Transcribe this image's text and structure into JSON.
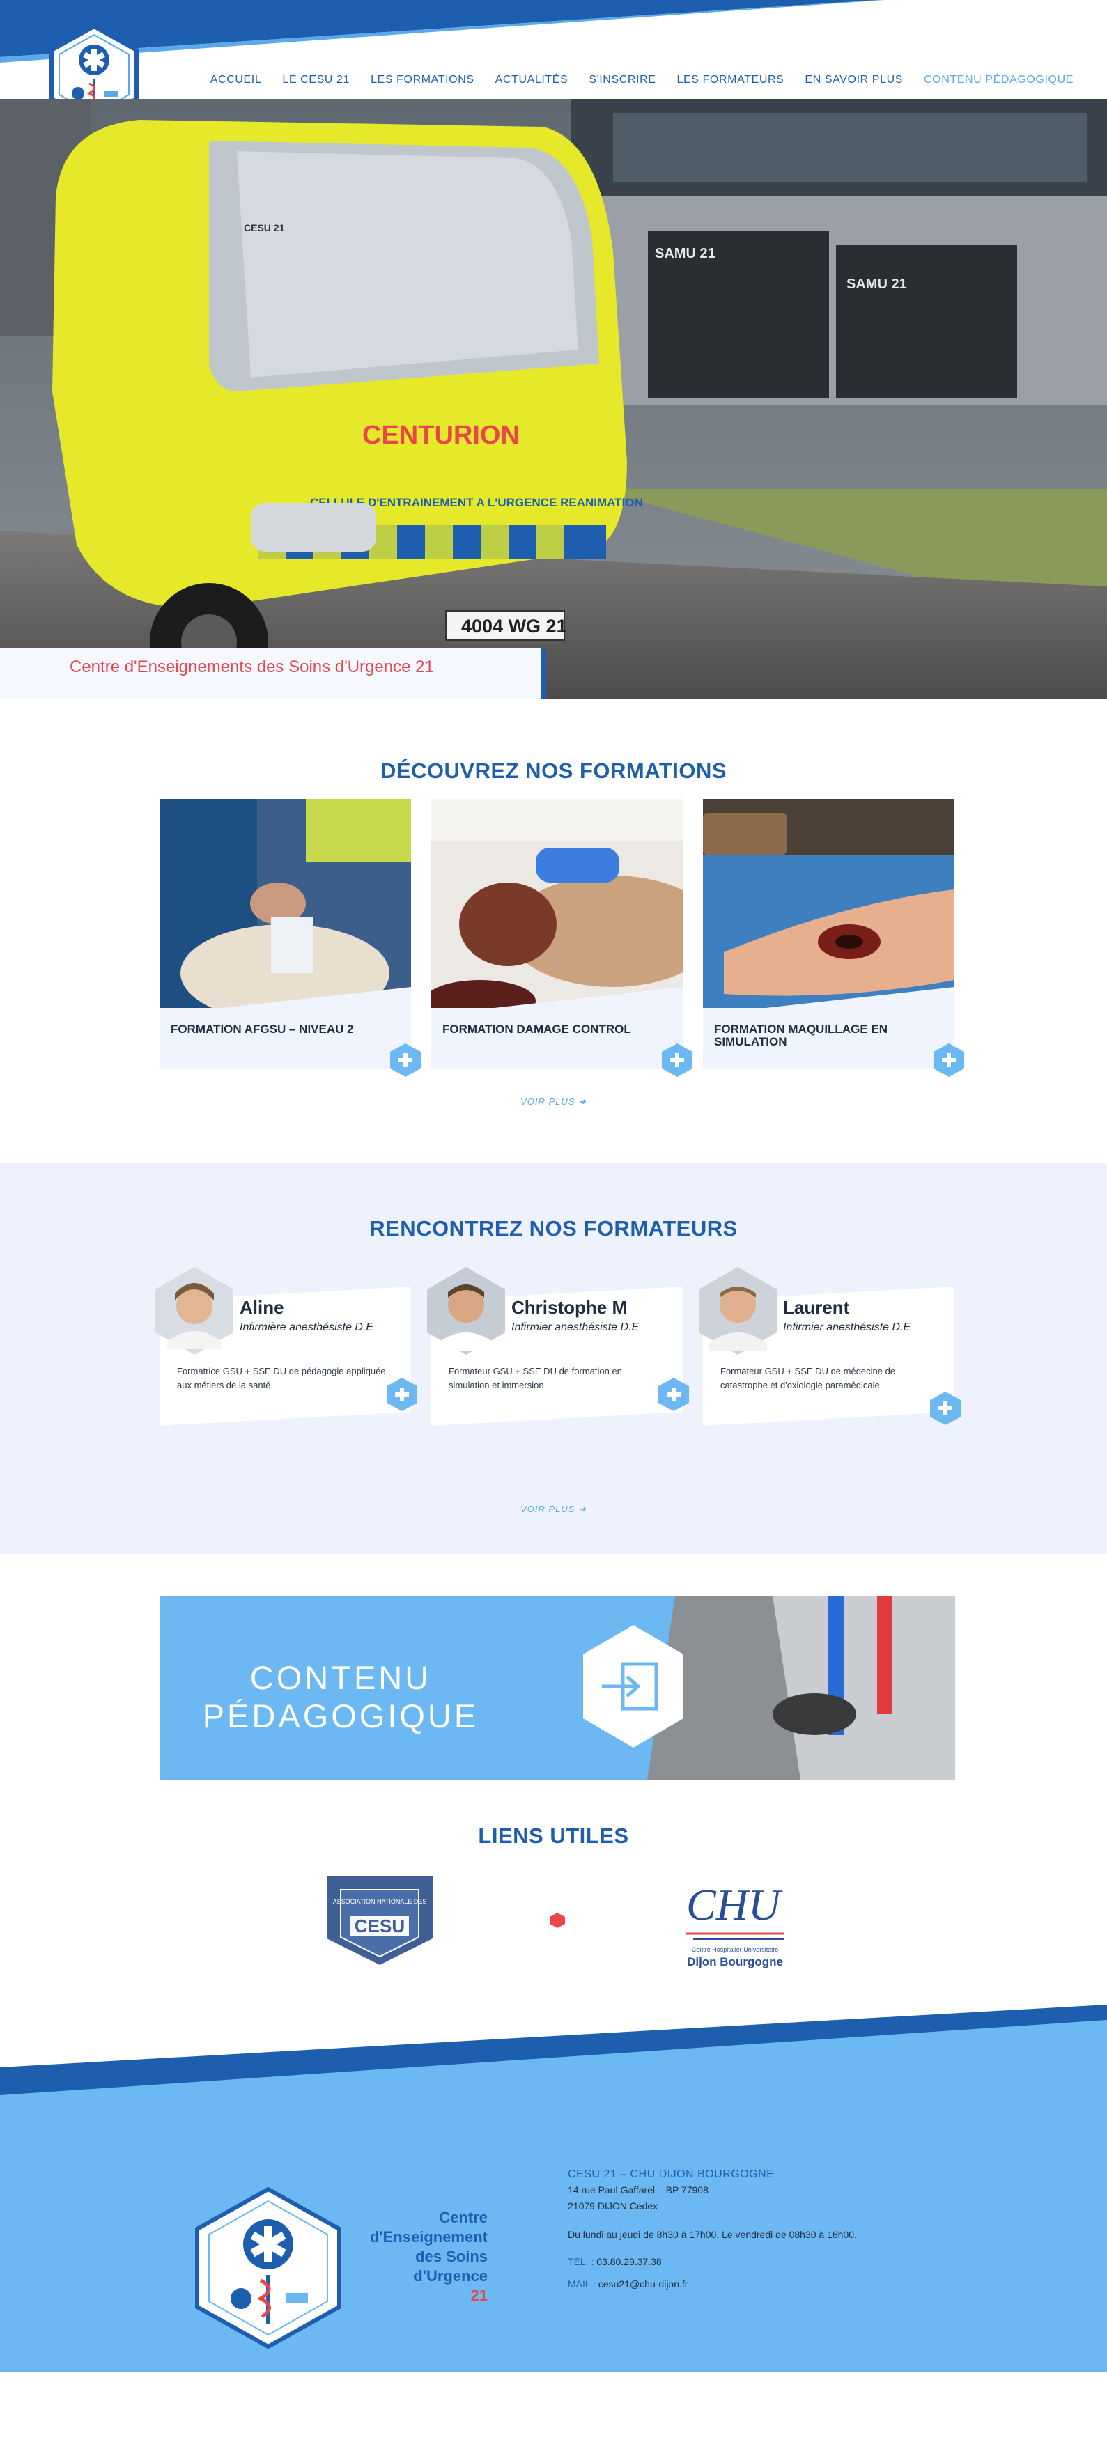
{
  "nav": {
    "items": [
      {
        "label": "ACCUEIL",
        "active": false
      },
      {
        "label": "LE CESU 21",
        "active": false
      },
      {
        "label": "LES FORMATIONS",
        "active": false
      },
      {
        "label": "ACTUALITÉS",
        "active": false
      },
      {
        "label": "S'INSCRIRE",
        "active": false
      },
      {
        "label": "LES FORMATEURS",
        "active": false
      },
      {
        "label": "EN SAVOIR PLUS",
        "active": false
      },
      {
        "label": "CONTENU PÉDAGOGIQUE",
        "active": true
      }
    ]
  },
  "hero": {
    "caption": "Centre d'Enseignements des Soins d'Urgence 21",
    "vehicle_brand": "CENTURION",
    "vehicle_slogan": "CELLULE D'ENTRAINEMENT A L'URGENCE REANIMATION",
    "vehicle_top": "CESU 21",
    "plate": "4004 WG 21",
    "building_sign_1": "SAMU 21",
    "building_sign_2": "SAMU 21"
  },
  "formations": {
    "title": "DÉCOUVREZ NOS FORMATIONS",
    "cards": [
      {
        "title": "FORMATION AFGSU – NIVEAU 2"
      },
      {
        "title": "FORMATION DAMAGE CONTROL"
      },
      {
        "title": "FORMATION MAQUILLAGE EN SIMULATION"
      }
    ],
    "more": "VOIR PLUS"
  },
  "formateurs": {
    "title": "RENCONTREZ NOS FORMATEURS",
    "items": [
      {
        "name": "Aline",
        "role": "Infirmière anesthésiste D.E",
        "desc": "Formatrice GSU + SSE DU de pédagogie appliquée aux métiers de la santé"
      },
      {
        "name": "Christophe M",
        "role": "Infirmier anesthésiste D.E",
        "desc": "Formateur GSU + SSE DU de formation en simulation et immersion"
      },
      {
        "name": "Laurent",
        "role": "Infirmier anesthésiste D.E",
        "desc": "Formateur GSU + SSE DU de médecine de catastrophe et d'oxiologie paramédicale"
      }
    ],
    "more": "VOIR PLUS"
  },
  "contenu": {
    "line1": "CONTENU",
    "line2": "PÉDAGOGIQUE"
  },
  "liens": {
    "title": "LIENS UTILES",
    "partner1_top": "ASSOCIATION NATIONALE DES",
    "partner1_main": "CESU",
    "partner2_main": "CHU",
    "partner2_sub": "Centre Hospitalier Universitaire",
    "partner2_city": "Dijon Bourgogne"
  },
  "footer": {
    "brand": [
      "Centre",
      "d'Enseignement",
      "des Soins",
      "d'Urgence",
      "21"
    ],
    "org": "CESU 21 – CHU DIJON BOURGOGNE",
    "address1": "14 rue Paul Gaffarel – BP 77908",
    "address2": "21079 DIJON Cedex",
    "hours": "Du lundi au jeudi de 8h30 à 17h00. Le vendredi de 08h30 à 16h00.",
    "tel_label": "TÉL. :",
    "tel": "03.80.29.37.38",
    "mail_label": "MAIL :",
    "mail": "cesu21@chu-dijon.fr"
  },
  "colors": {
    "primary": "#1d5fae",
    "light": "#5aa9ea",
    "sky": "#6cb8f3",
    "accent": "#e8464b",
    "pale": "#edf2fd"
  },
  "icons": [
    "star-of-life-icon",
    "plus-icon",
    "arrow-right-icon",
    "login-door-icon"
  ]
}
